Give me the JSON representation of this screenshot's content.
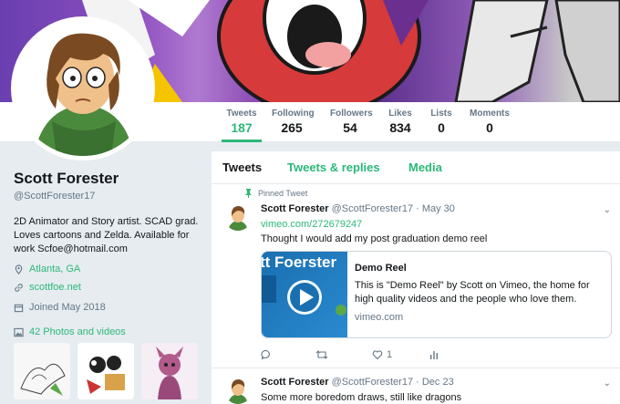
{
  "profile": {
    "name": "Scott Forester",
    "handle": "@ScottForester17",
    "bio": "2D Animator and Story artist. SCAD grad. Loves cartoons and Zelda. Available for work Scfoe@hotmail.com",
    "location": "Atlanta, GA",
    "website": "scottfoe.net",
    "joined": "Joined May 2018",
    "photos_label": "42 Photos and videos"
  },
  "stats": [
    {
      "label": "Tweets",
      "value": "187"
    },
    {
      "label": "Following",
      "value": "265"
    },
    {
      "label": "Followers",
      "value": "54"
    },
    {
      "label": "Likes",
      "value": "834"
    },
    {
      "label": "Lists",
      "value": "0"
    },
    {
      "label": "Moments",
      "value": "0"
    }
  ],
  "tabs": [
    "Tweets",
    "Tweets & replies",
    "Media"
  ],
  "tweets": [
    {
      "pinned_label": "Pinned Tweet",
      "name": "Scott Forester",
      "meta": "@ScottForester17 · May 30",
      "link": "vimeo.com/272679247",
      "text": "Thought I would add my post graduation demo reel",
      "card": {
        "title": "Demo Reel",
        "description": "This is \"Demo Reel\" by Scott on Vimeo, the home for high quality videos and the people who love them.",
        "domain": "vimeo.com",
        "image_text": "tt Foerster"
      },
      "likes": "1"
    },
    {
      "name": "Scott Forester",
      "meta": "@ScottForester17 · Dec 23",
      "text": "Some more boredom draws, still like dragons"
    }
  ],
  "colors": {
    "accent": "#2cb87a",
    "muted": "#657786",
    "background": "#e6ecf0"
  }
}
